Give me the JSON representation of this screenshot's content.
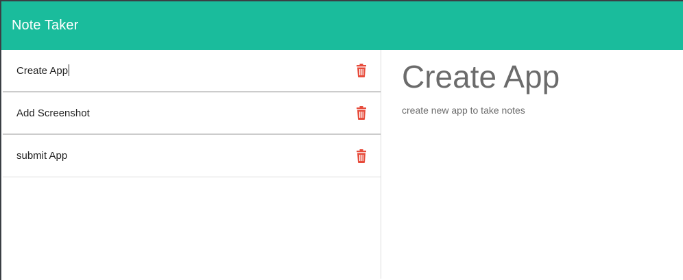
{
  "app": {
    "brand": "Note Taker"
  },
  "notes": [
    {
      "title": "Create App"
    },
    {
      "title": "Add Screenshot"
    },
    {
      "title": "submit App"
    }
  ],
  "editor": {
    "title": "Create App",
    "text": "create new app to take notes"
  },
  "colors": {
    "navbar": "#1abc9c",
    "delete_icon": "#e74c3c",
    "text_muted": "#6b6b6b"
  },
  "icons": {
    "delete": "trash-icon"
  }
}
